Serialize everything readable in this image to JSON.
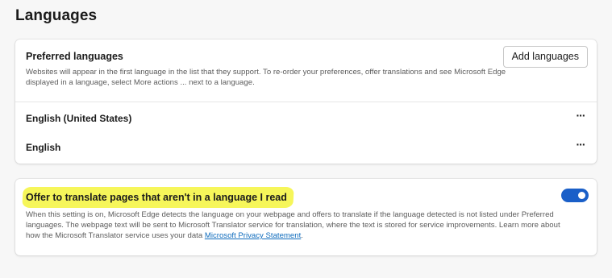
{
  "page": {
    "title": "Languages"
  },
  "preferred": {
    "header": "Preferred languages",
    "description": "Websites will appear in the first language in the list that they support. To re-order your preferences, offer translations and see Microsoft Edge displayed in a language, select More actions ... next to a language.",
    "add_button": "Add languages",
    "languages": [
      {
        "label": "English (United States)",
        "more": "···"
      },
      {
        "label": "English",
        "more": "···"
      }
    ]
  },
  "translate": {
    "title": "Offer to translate pages that aren't in a language I read",
    "description": "When this setting is on, Microsoft Edge detects the language on your webpage and offers to translate if the language detected is not listed under Preferred languages. The webpage text will be sent to Microsoft Translator service for translation, where the text is stored for service improvements. Learn more about how the Microsoft Translator service uses your data ",
    "link": "Microsoft Privacy Statement",
    "suffix": ".",
    "toggle_on": true,
    "highlight_color": "#f6f65a"
  },
  "colors": {
    "accent": "#1a5fc8",
    "link": "#0f6cbd"
  }
}
